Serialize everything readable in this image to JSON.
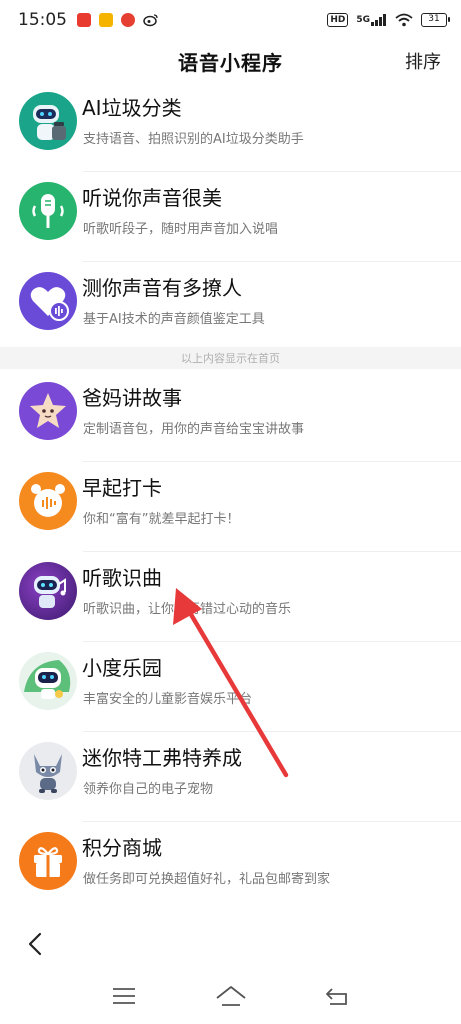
{
  "status_bar": {
    "time": "15:05",
    "network": "5G",
    "hd": "HD",
    "battery": "31",
    "app_icon_colors": [
      "#e83a2e",
      "#f5b400",
      "#e64033"
    ]
  },
  "header": {
    "title": "语音小程序",
    "sort_label": "排序"
  },
  "section_note": "以上内容显示在首页",
  "items": [
    {
      "title": "AI垃圾分类",
      "desc": "支持语音、拍照识别的AI垃圾分类助手",
      "icon": "robot-trash-icon",
      "icon_bg": "#1aa58a"
    },
    {
      "title": "听说你声音很美",
      "desc": "听歌听段子，随时用声音加入说唱",
      "icon": "microphone-icon",
      "icon_bg": "#27b46e"
    },
    {
      "title": "测你声音有多撩人",
      "desc": "基于AI技术的声音颜值鉴定工具",
      "icon": "heart-voice-icon",
      "icon_bg": "#6a4bd8"
    },
    {
      "title": "爸妈讲故事",
      "desc": "定制语音包，用你的声音给宝宝讲故事",
      "icon": "star-face-icon",
      "icon_bg": "#7a49d6"
    },
    {
      "title": "早起打卡",
      "desc": "你和“富有”就差早起打卡！",
      "icon": "alarm-clock-icon",
      "icon_bg": "#f58a1f"
    },
    {
      "title": "听歌识曲",
      "desc": "听歌识曲，让你不再错过心动的音乐",
      "icon": "music-robot-icon",
      "icon_bg": "#5a2a8e"
    },
    {
      "title": "小度乐园",
      "desc": "丰富安全的儿童影音娱乐平台",
      "icon": "xiaodu-robot-icon",
      "icon_bg": "#e8f3ec"
    },
    {
      "title": "迷你特工弗特养成",
      "desc": "领养你自己的电子宠物",
      "icon": "cat-pet-icon",
      "icon_bg": "#e9ebef"
    },
    {
      "title": "积分商城",
      "desc": "做任务即可兑换超值好礼，礼品包邮寄到家",
      "icon": "gift-icon",
      "icon_bg": "#f57a1a"
    }
  ],
  "nav": {
    "back": "back-icon",
    "menu": "menu-icon",
    "home": "home-icon",
    "return": "return-icon"
  },
  "annotation_color": "#e8393a"
}
